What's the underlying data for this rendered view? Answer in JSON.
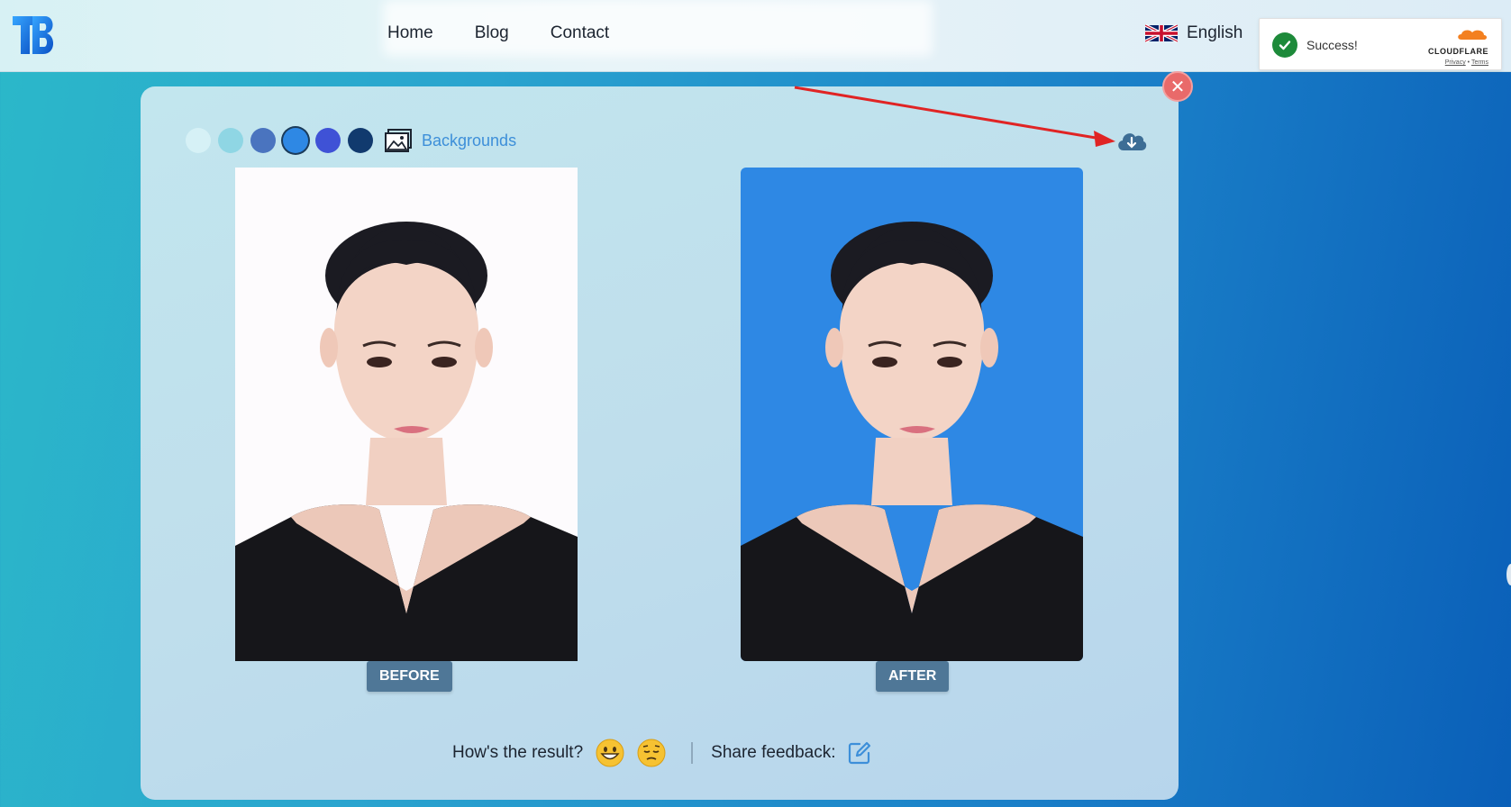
{
  "header": {
    "logo_icon": "tb-logo-icon",
    "nav": [
      {
        "label": "Home"
      },
      {
        "label": "Blog"
      },
      {
        "label": "Contact"
      }
    ],
    "language": {
      "label": "English",
      "flag_icon": "uk-flag-icon"
    }
  },
  "cloudflare": {
    "status": "Success!",
    "brand": "CLOUDFLARE",
    "privacy": "Privacy",
    "separator": "•",
    "terms": "Terms"
  },
  "editor": {
    "swatches": [
      {
        "color": "#d6f1f6",
        "selected": false
      },
      {
        "color": "#8fd6e4",
        "selected": false
      },
      {
        "color": "#4a74bf",
        "selected": false
      },
      {
        "color": "#2e88e4",
        "selected": true
      },
      {
        "color": "#3f52d6",
        "selected": false
      },
      {
        "color": "#113a6e",
        "selected": false
      }
    ],
    "backgrounds_label": "Backgrounds",
    "before_label": "BEFORE",
    "after_label": "AFTER",
    "before_bg": "#fdfbfd",
    "after_bg": "#2e88e4"
  },
  "feedback": {
    "question": "How's the result?",
    "share_label": "Share feedback:"
  },
  "colors": {
    "accent": "#3d8fd9",
    "close": "#e96a6a",
    "tag": "#4f7797",
    "annotation_arrow": "#e02424"
  }
}
